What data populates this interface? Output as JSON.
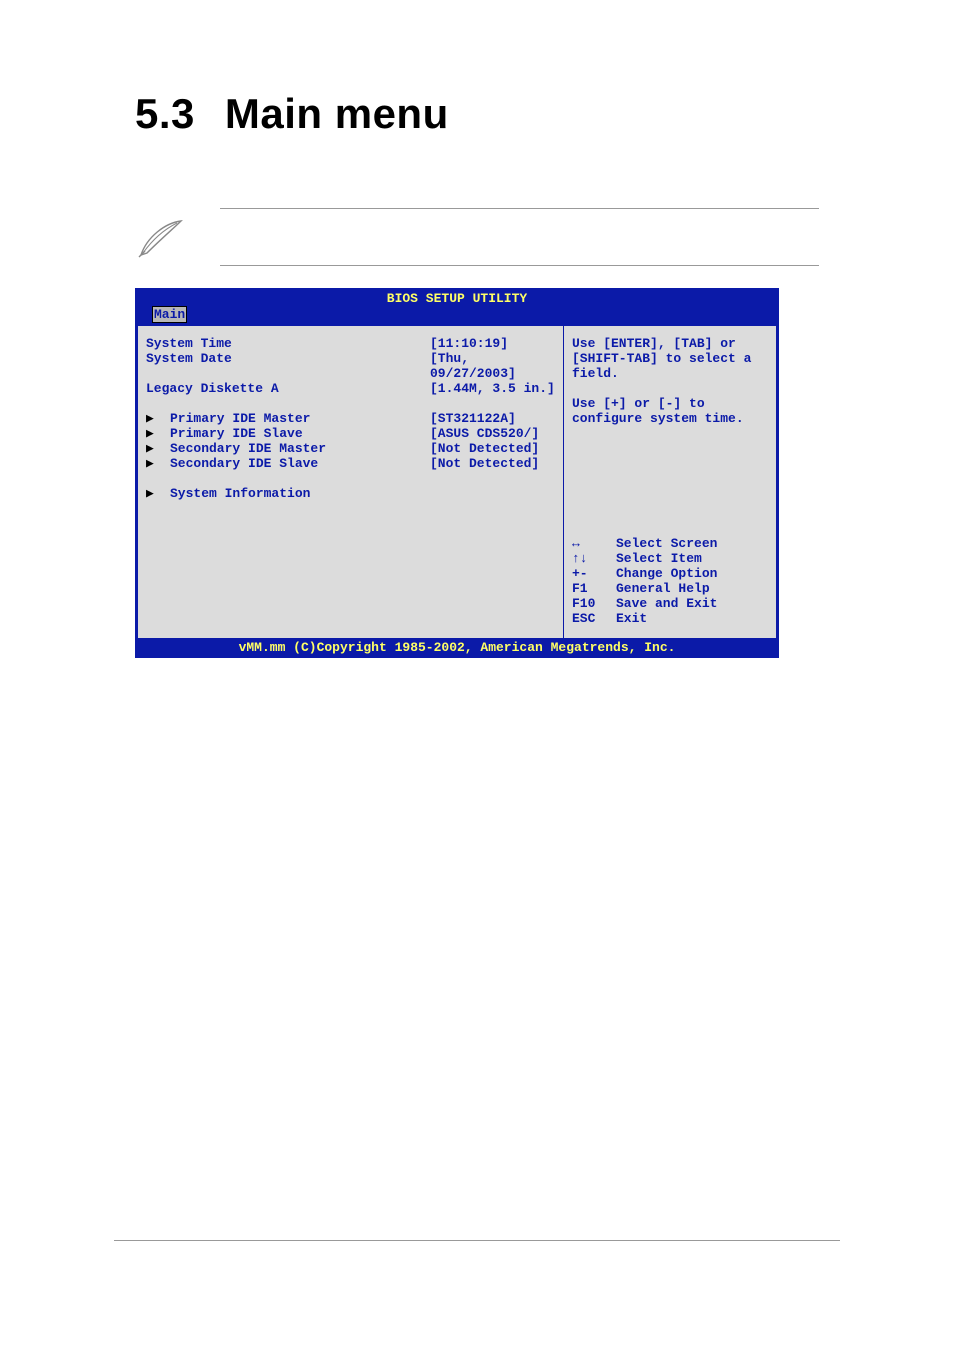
{
  "heading": {
    "number": "5.3",
    "title": "Main menu"
  },
  "bios": {
    "title": "BIOS SETUP UTILITY",
    "active_tab": "Main",
    "simple_rows": [
      {
        "label": "System Time",
        "value": "[11:10:19]"
      },
      {
        "label": "System Date",
        "value": "[Thu, 09/27/2003]"
      },
      {
        "label": "Legacy Diskette A",
        "value": "[1.44M, 3.5 in.]"
      }
    ],
    "arrow_rows": [
      {
        "label": "Primary IDE Master",
        "value": "[ST321122A]"
      },
      {
        "label": "Primary IDE Slave",
        "value": "[ASUS CDS520/]"
      },
      {
        "label": "Secondary IDE Master",
        "value": "[Not Detected]"
      },
      {
        "label": "Secondary IDE Slave",
        "value": "[Not Detected]"
      }
    ],
    "last_arrow_row": {
      "label": "System Information",
      "value": ""
    },
    "help": {
      "line1": "Use [ENTER], [TAB] or",
      "line2": "[SHIFT-TAB] to select a",
      "line3": "field.",
      "line4": "Use [+] or [-] to",
      "line5": "configure system time."
    },
    "nav": [
      {
        "key": "↔",
        "label": "Select Screen"
      },
      {
        "key": "↑↓",
        "label": "Select Item"
      },
      {
        "key": "+-",
        "label": "Change Option"
      },
      {
        "key": "F1",
        "label": "General Help"
      },
      {
        "key": "F10",
        "label": "Save and Exit"
      },
      {
        "key": "ESC",
        "label": "Exit"
      }
    ],
    "footer": "vMM.mm (C)Copyright 1985-2002, American Megatrends, Inc."
  }
}
